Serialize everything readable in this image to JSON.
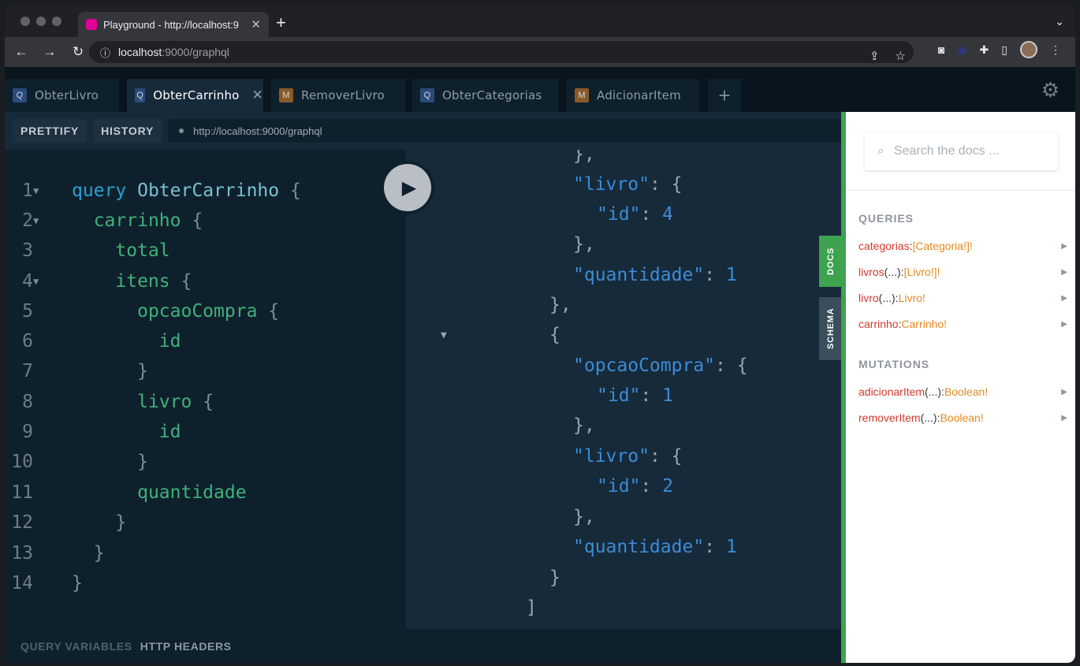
{
  "browser": {
    "tab_title": "Playground - http://localhost:9",
    "url_host": "localhost",
    "url_path": ":9000/graphql"
  },
  "playground": {
    "tabs": [
      {
        "badge": "Q",
        "label": "ObterLivro"
      },
      {
        "badge": "Q",
        "label": "ObterCarrinho"
      },
      {
        "badge": "M",
        "label": "RemoverLivro"
      },
      {
        "badge": "Q",
        "label": "ObterCategorias"
      },
      {
        "badge": "M",
        "label": "AdicionarItem"
      }
    ],
    "toolbar": {
      "prettify": "PRETTIFY",
      "history": "HISTORY",
      "endpoint": "http://localhost:9000/graphql"
    },
    "editor_line_numbers": [
      "1",
      "2",
      "3",
      "4",
      "5",
      "6",
      "7",
      "8",
      "9",
      "10",
      "11",
      "12",
      "13",
      "14"
    ],
    "bottom": {
      "query_variables": "QUERY VARIABLES",
      "http_headers": "HTTP HEADERS"
    },
    "side_tabs": {
      "docs": "DOCS",
      "schema": "SCHEMA"
    }
  },
  "editor": {
    "l1": {
      "kw": "query",
      "op": "ObterCarrinho",
      "br": "{"
    },
    "l2": {
      "fld": "carrinho",
      "br": "{"
    },
    "l3": {
      "fld": "total"
    },
    "l4": {
      "fld": "itens",
      "br": "{"
    },
    "l5": {
      "fld": "opcaoCompra",
      "br": "{"
    },
    "l6": {
      "fld": "id"
    },
    "l7": {
      "br": "}"
    },
    "l8": {
      "fld": "livro",
      "br": "{"
    },
    "l9": {
      "fld": "id"
    },
    "l10": {
      "br": "}"
    },
    "l11": {
      "fld": "quantidade"
    },
    "l12": {
      "br": "}"
    },
    "l13": {
      "br": "}"
    },
    "l14": {
      "br": "}"
    }
  },
  "result": {
    "r0": "},",
    "r1k": "\"livro\"",
    "r1p": ": {",
    "r2k": "\"id\"",
    "r2v": "4",
    "r3": "},",
    "r4k": "\"quantidade\"",
    "r4v": "1",
    "r5": "},",
    "r6": "{",
    "r7k": "\"opcaoCompra\"",
    "r7p": ": {",
    "r8k": "\"id\"",
    "r8v": "1",
    "r9": "},",
    "r10k": "\"livro\"",
    "r10p": ": {",
    "r11k": "\"id\"",
    "r11v": "2",
    "r12": "},",
    "r13k": "\"quantidade\"",
    "r13v": "1",
    "r14": "}",
    "r15": "]",
    "colon": ": "
  },
  "docs": {
    "search_placeholder": "Search the docs ...",
    "queries_title": "QUERIES",
    "mutations_title": "MUTATIONS",
    "queries": [
      {
        "name": "categorias",
        "args": "",
        "type": "[Categoria!]!"
      },
      {
        "name": "livros",
        "args": "(...)",
        "type": "[Livro!]!"
      },
      {
        "name": "livro",
        "args": "(...)",
        "type": "Livro!"
      },
      {
        "name": "carrinho",
        "args": "",
        "type": "Carrinho!"
      }
    ],
    "mutations": [
      {
        "name": "adicionarItem",
        "args": "(...)",
        "type": "Boolean!"
      },
      {
        "name": "removerItem",
        "args": "(...)",
        "type": "Boolean!"
      }
    ],
    "sep": ": "
  },
  "colors": {
    "accent_green": "#3ea34f",
    "field_green": "#3fb17a",
    "keyword_blue": "#26a0d0",
    "doc_name_red": "#d0392e",
    "doc_type_orange": "#e68a1d"
  },
  "icons": [
    "back-icon",
    "forward-icon",
    "reload-icon",
    "info-icon",
    "share-icon",
    "star-icon",
    "camera-icon",
    "extension-icon",
    "puzzle-icon",
    "sidebar-icon",
    "more-icon",
    "gear-icon",
    "search-icon",
    "play-icon",
    "plus-icon",
    "close-icon"
  ]
}
